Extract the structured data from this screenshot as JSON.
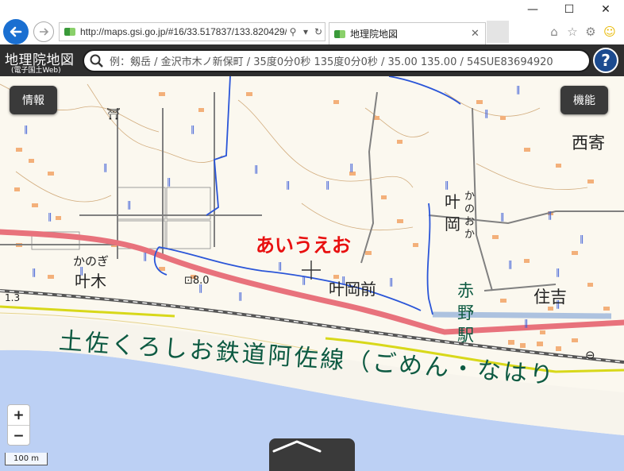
{
  "browser": {
    "url": "http://maps.gsi.go.jp/#16/33.517837/133.820429/",
    "tab_title": "地理院地図",
    "icons": [
      "back-icon",
      "forward-icon",
      "search-icon",
      "refresh-icon",
      "close-icon",
      "home-icon",
      "star-icon",
      "gear-icon",
      "smiley-icon"
    ]
  },
  "header": {
    "logo_main": "地理院地図",
    "logo_sub": "(電子国土Web)",
    "search_placeholder": "例：剱岳 / 金沢市木ノ新保町 / 35度0分0秒 135度0分0秒 / 35.00 135.00 / 54SUE83694920",
    "help": "?"
  },
  "map": {
    "info_button": "情報",
    "functions_button": "機能",
    "zoom_in": "+",
    "zoom_out": "−",
    "scale_label": "100 m",
    "colors": {
      "road": "#e8727c",
      "river": "#2a55d8",
      "sea": "#bcd0f4",
      "railway": "#555555",
      "annotation": "#e81010",
      "railway_name": "#0d5a42"
    },
    "labels": {
      "annotation": "あいうえお",
      "nishiyori": "西寄",
      "kanooka_kanji": "叶岡",
      "kanooka_kana": "かのおか",
      "kanogi_kana": "かのぎ",
      "kanogi_kanji": "叶木",
      "elevation": "8.0",
      "kanooka_mae": "叶岡前",
      "akano_station": "赤野駅",
      "sumiyoshi": "住吉",
      "elevation_left": "1.3",
      "railway_line": "土佐くろしお鉄道阿佐線（ごめん・なはり"
    }
  }
}
